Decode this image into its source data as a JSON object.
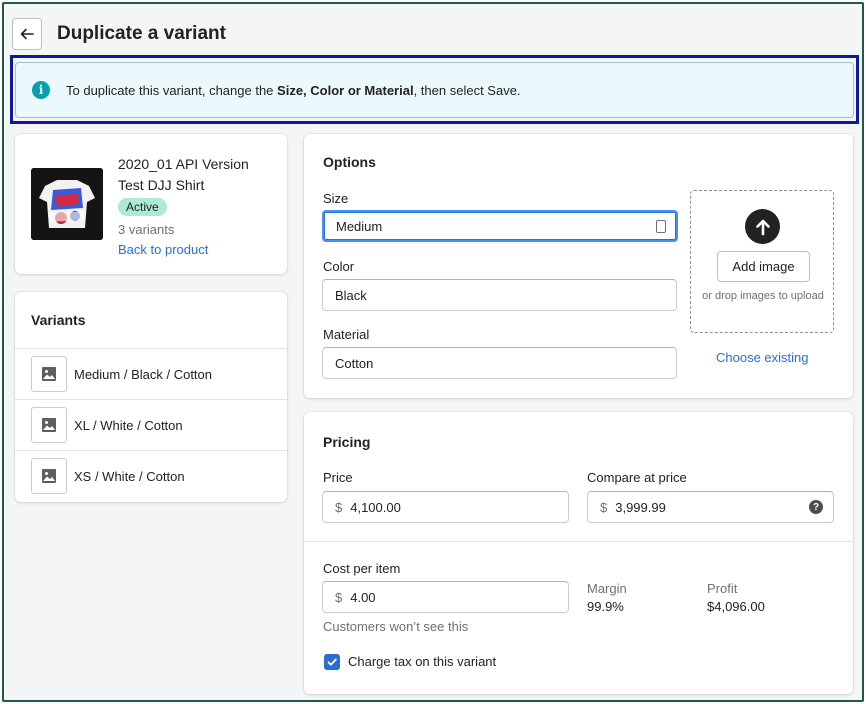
{
  "header": {
    "title": "Duplicate a variant"
  },
  "banner": {
    "text_before": "To duplicate this variant, change the ",
    "text_bold": "Size, Color or Material",
    "text_after": ", then select Save."
  },
  "product": {
    "title": "2020_01 API Version Test DJJ Shirt",
    "status": "Active",
    "variant_count": "3 variants",
    "back_link": "Back to product"
  },
  "variants": {
    "title": "Variants",
    "items": [
      {
        "label": "Medium / Black / Cotton"
      },
      {
        "label": "XL / White / Cotton"
      },
      {
        "label": "XS / White / Cotton"
      }
    ]
  },
  "options": {
    "title": "Options",
    "size": {
      "label": "Size",
      "value": "Medium"
    },
    "color": {
      "label": "Color",
      "value": "Black"
    },
    "material": {
      "label": "Material",
      "value": "Cotton"
    },
    "add_image": "Add image",
    "drop_hint": "or drop images to upload",
    "choose_existing": "Choose existing"
  },
  "pricing": {
    "title": "Pricing",
    "price": {
      "label": "Price",
      "currency": "$",
      "value": "4,100.00"
    },
    "compare": {
      "label": "Compare at price",
      "currency": "$",
      "value": "3,999.99"
    },
    "cost": {
      "label": "Cost per item",
      "currency": "$",
      "value": "4.00",
      "help": "Customers won’t see this"
    },
    "margin": {
      "label": "Margin",
      "value": "99.9%"
    },
    "profit": {
      "label": "Profit",
      "value": "$4,096.00"
    },
    "charge_tax": {
      "label": "Charge tax on this variant",
      "checked": true
    }
  }
}
